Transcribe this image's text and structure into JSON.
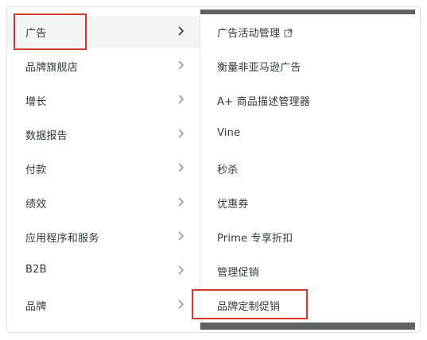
{
  "left_menu": {
    "items": [
      {
        "label": "广告"
      },
      {
        "label": "品牌旗舰店"
      },
      {
        "label": "增长"
      },
      {
        "label": "数据报告"
      },
      {
        "label": "付款"
      },
      {
        "label": "绩效"
      },
      {
        "label": "应用程序和服务"
      },
      {
        "label": "B2B"
      },
      {
        "label": "品牌"
      }
    ],
    "active_item": "广告"
  },
  "right_menu": {
    "items": [
      {
        "label": "广告活动管理",
        "icon": "external-link-icon"
      },
      {
        "label": "衡量非亚马逊广告"
      },
      {
        "label": "A+ 商品描述管理器"
      },
      {
        "label": "Vine"
      },
      {
        "label": "秒杀"
      },
      {
        "label": "优惠券"
      },
      {
        "label": "Prime 专享折扣"
      },
      {
        "label": "管理促销"
      },
      {
        "label": "品牌定制促销"
      }
    ]
  },
  "highlight_color": "#d03a2d"
}
